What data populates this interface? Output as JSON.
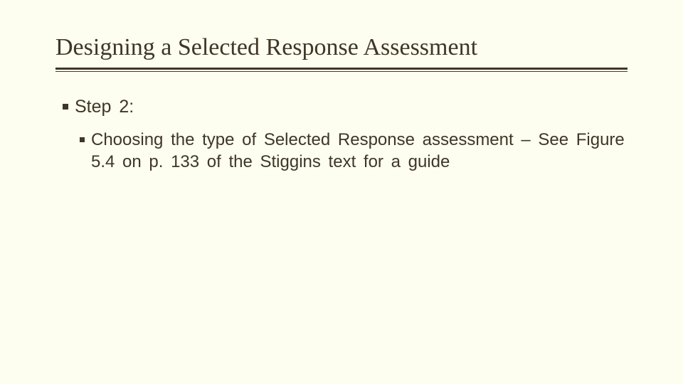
{
  "title": "Designing a Selected Response Assessment",
  "bullets": {
    "level1": "Step 2:",
    "level2": "Choosing the type of Selected Response assessment – See Figure 5.4 on p. 133 of the Stiggins text for a guide"
  }
}
